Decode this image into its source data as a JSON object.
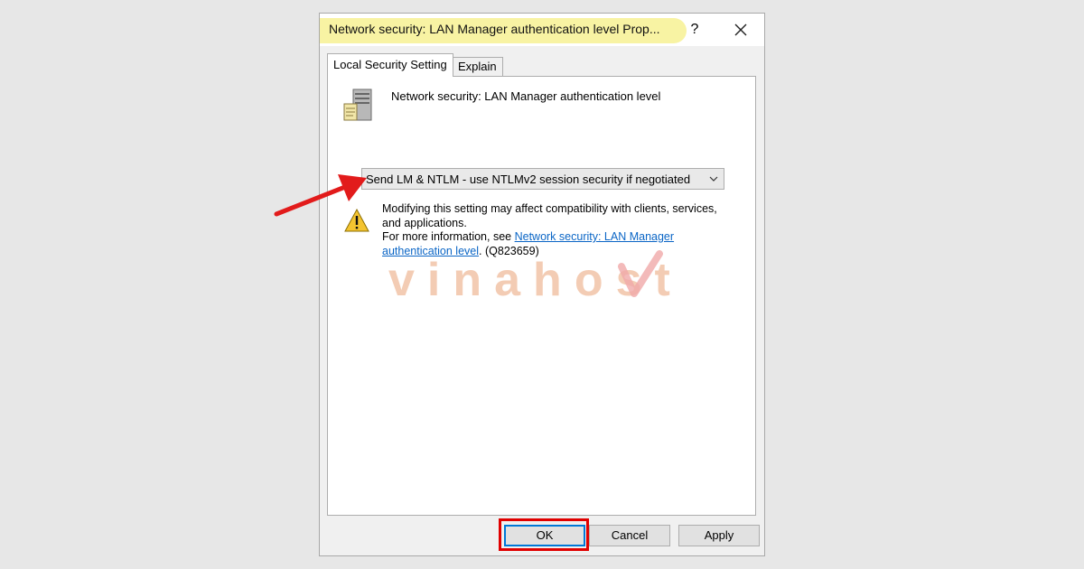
{
  "window": {
    "title": "Network security: LAN Manager authentication level Prop...",
    "help_label": "?",
    "close_icon": "close-icon"
  },
  "tabs": [
    {
      "label": "Local Security Setting",
      "active": true
    },
    {
      "label": "Explain",
      "active": false
    }
  ],
  "policy": {
    "name": "Network security: LAN Manager authentication level",
    "icon": "server-icon"
  },
  "dropdown": {
    "selected": "Send LM & NTLM - use NTLMv2 session security if negotiated",
    "icon": "chevron-down-icon"
  },
  "warning": {
    "icon": "warning-icon",
    "line1": "Modifying this setting may affect compatibility with clients, services, and applications.",
    "more_prefix": "For more information, see ",
    "link_text": "Network security: LAN Manager authentication level",
    "suffix": ". (Q823659)"
  },
  "watermark": {
    "text": "vinahost."
  },
  "buttons": {
    "ok": "OK",
    "cancel": "Cancel",
    "apply": "Apply"
  },
  "annotations": {
    "arrow_color": "#e21b1b",
    "highlight_color": "#e00000"
  }
}
